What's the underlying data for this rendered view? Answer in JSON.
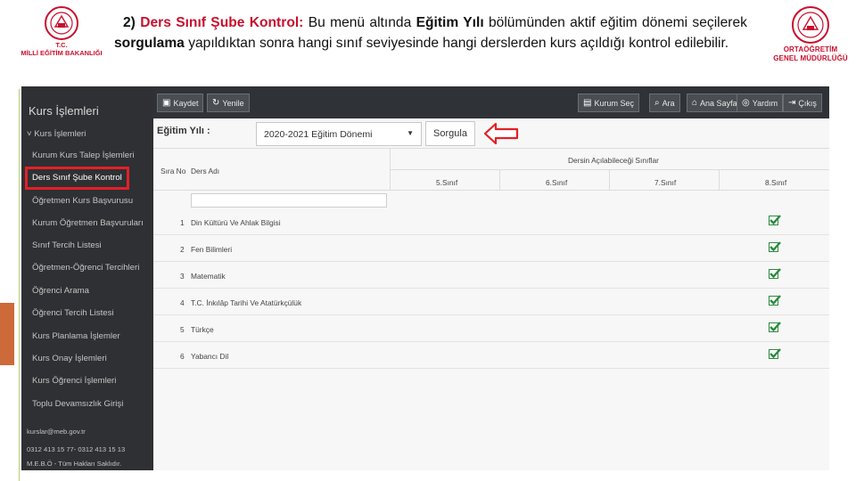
{
  "slide": {
    "left_logo_caption_1": "T.C.",
    "left_logo_caption_2": "MİLLİ EĞİTİM BAKANLIĞI",
    "right_logo_caption_1": "ORTAÖĞRETİM",
    "right_logo_caption_2": "GENEL MÜDÜRLÜĞÜ",
    "text": {
      "number": "2)",
      "title": "Ders Sınıf Şube Kontrol:",
      "part1": " Bu menü altında ",
      "bold1": "Eğitim Yılı",
      "part2": " bölümünden aktif eğitim dönemi seçilerek ",
      "bold2": "sorgulama",
      "part3": " yapıldıktan sonra hangi sınıf seviyesinde hangi derslerden kurs açıldığı kontrol edilebilir."
    },
    "colors": {
      "brand_red": "#c8102e",
      "highlight_red": "#e32027",
      "accent_green": "#b9d27a",
      "accent_orange": "#cc6a3a"
    }
  },
  "sidebar": {
    "title": "Kurs İşlemleri",
    "items": [
      {
        "label": "˅ Kurs İşlemleri"
      },
      {
        "label": "Kurum Kurs Talep İşlemleri"
      },
      {
        "label": "Ders Sınıf Şube Kontrol"
      },
      {
        "label": "Öğretmen Kurs Başvurusu"
      },
      {
        "label": "Kurum Öğretmen Başvuruları"
      },
      {
        "label": "Sınıf Tercih Listesi"
      },
      {
        "label": "Öğretmen-Öğrenci Tercihleri"
      },
      {
        "label": "Öğrenci Arama"
      },
      {
        "label": "Öğrenci Tercih Listesi"
      },
      {
        "label": "Kurs Planlama İşlemler"
      },
      {
        "label": "Kurs Onay İşlemleri"
      },
      {
        "label": "Kurs Öğrenci İşlemleri"
      },
      {
        "label": "Toplu Devamsızlık Girişi"
      }
    ],
    "footer": {
      "email": "kurslar@meb.gov.tr",
      "phone": "0312 413 15 77- 0312 413 15 13",
      "copyright": "M.E.B.Ö - Tüm Hakları Saklıdır."
    }
  },
  "toolbar": {
    "kaydet": "Kaydet",
    "yenile": "Yenile",
    "kurum_sec": "Kurum Seç",
    "ara": "Ara",
    "ana_sayfa": "Ana Sayfa",
    "yardim": "Yardım",
    "cikis": "Çıkış"
  },
  "filter": {
    "year_label": "Eğitim Yılı :",
    "year_value": "2020-2021 Eğitim Dönemi",
    "query_button": "Sorgula"
  },
  "table": {
    "col_sira": "Sıra No",
    "col_ders": "Ders Adı",
    "group_header": "Dersin Açılabileceği Sınıflar",
    "grades": [
      "5.Sınıf",
      "6.Sınıf",
      "7.Sınıf",
      "8.Sınıf"
    ],
    "rows": [
      {
        "no": "1",
        "name": "Din Kültürü Ve Ahlak Bilgisi",
        "grade8_checked": true
      },
      {
        "no": "2",
        "name": "Fen Bilimleri",
        "grade8_checked": true
      },
      {
        "no": "3",
        "name": "Matematik",
        "grade8_checked": true
      },
      {
        "no": "4",
        "name": "T.C. İnkılâp Tarihi Ve Atatürkçülük",
        "grade8_checked": true
      },
      {
        "no": "5",
        "name": "Türkçe",
        "grade8_checked": true
      },
      {
        "no": "6",
        "name": "Yabancı Dil",
        "grade8_checked": true
      }
    ]
  }
}
